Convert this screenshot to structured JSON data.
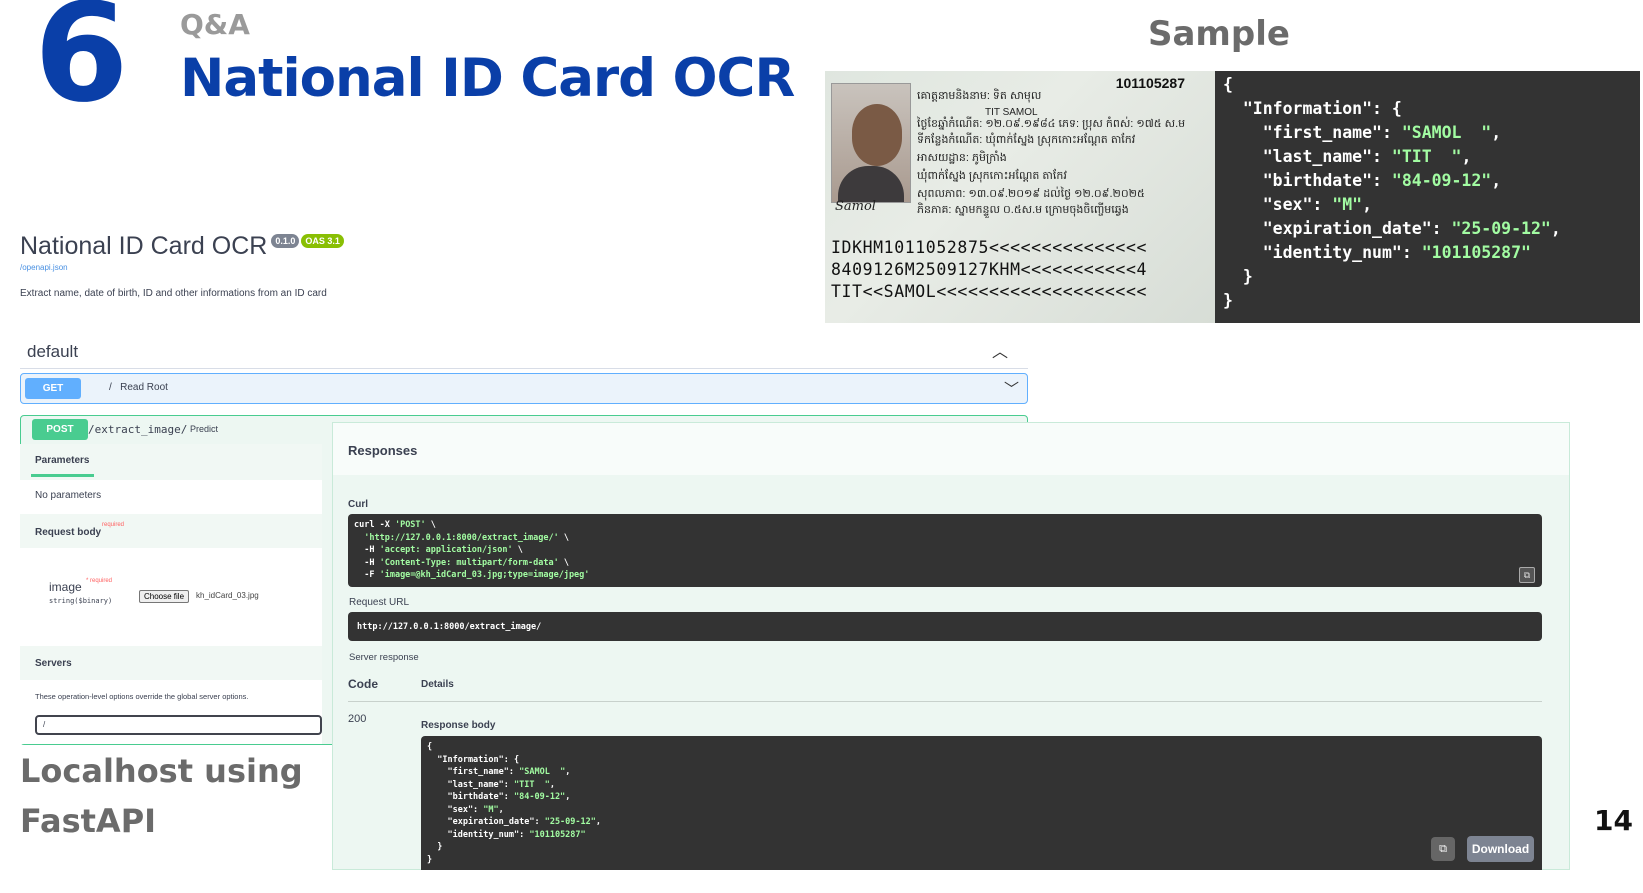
{
  "slide": {
    "number": "6",
    "section": "Q&A",
    "title": "National ID Card OCR",
    "sample_label": "Sample",
    "caption_line1": "Localhost using",
    "caption_line2": "FastAPI",
    "page_number": "14"
  },
  "id_card": {
    "id_number": "101105287",
    "name_en": "TIT SAMOL",
    "khmer_line1": "គោត្តនាមនិងនាម: ទិត សាមុល",
    "khmer_line2": "ថ្ងៃខែឆ្នាំកំណើត: ១២.០៩.១៩៨៤ ភេទ: ប្រុស កំពស់: ១៧៥ ស.ម",
    "khmer_line3": "ទីកន្លែងកំណើត: ឃុំពាក់ស្នែង ស្រុកកោះអណ្តែត តាកែវ",
    "khmer_line4": "អាសយដ្ឋាន: ភូមិក្រាំង",
    "khmer_line5": "ឃុំពាក់ស្នែង ស្រុកកោះអណ្តែត តាកែវ",
    "khmer_line6": "សុពលភាព: ១៣.០៩.២០១៩ ដល់ថ្ងៃ ១២.០៩.២០២៥",
    "khmer_line7": "ភិនភាគ: ស្នាមកន្ទួល ០.៥ស.ម ក្រោមចុងចិញ្ចើមឆ្វេង",
    "signature": "Samol",
    "mrz": [
      "IDKHM1011052875<<<<<<<<<<<<<<<",
      "8409126M2509127KHM<<<<<<<<<<<4",
      "TIT<<SAMOL<<<<<<<<<<<<<<<<<<<<"
    ]
  },
  "json_sample": {
    "open": "{",
    "information_key": "\"Information\": {",
    "fields": [
      {
        "key": "\"first_name\": ",
        "value": "\"SAMOL  \"",
        "tail": ","
      },
      {
        "key": "\"last_name\": ",
        "value": "\"TIT  \"",
        "tail": ","
      },
      {
        "key": "\"birthdate\": ",
        "value": "\"84-09-12\"",
        "tail": ","
      },
      {
        "key": "\"sex\": ",
        "value": "\"M\"",
        "tail": ","
      },
      {
        "key": "\"expiration_date\": ",
        "value": "\"25-09-12\"",
        "tail": ","
      },
      {
        "key": "\"identity_num\": ",
        "value": "\"101105287\"",
        "tail": ""
      }
    ],
    "inner_close": "}",
    "close": "}"
  },
  "swagger": {
    "title": "National ID Card OCR",
    "version": "0.1.0",
    "oas": "OAS 3.1",
    "openapi_link": "/openapi.json",
    "description": "Extract name, date of birth, ID and other informations from an ID card",
    "tag": "default",
    "get": {
      "method": "GET",
      "path": "/",
      "summary": "Read Root"
    },
    "post": {
      "method": "POST",
      "path": "/extract_image/",
      "summary": "Predict"
    },
    "parameters_tab": "Parameters",
    "no_parameters": "No parameters",
    "request_body": "Request body",
    "required": "required",
    "image_label": "image",
    "image_required": "* required",
    "image_type": "string($binary)",
    "choose_file": "Choose file",
    "file_name": "kh_idCard_03.jpg",
    "servers_label": "Servers",
    "servers_note": "These operation-level options override the global server options.",
    "server_value": "/",
    "responses_title": "Responses",
    "curl_label": "Curl",
    "curl": [
      {
        "a": "curl -X ",
        "s": "'POST'",
        "b": " \\"
      },
      {
        "a": "  ",
        "s": "'http://127.0.0.1:8000/extract_image/'",
        "b": " \\"
      },
      {
        "a": "  -H ",
        "s": "'accept: application/json'",
        "b": " \\"
      },
      {
        "a": "  -H ",
        "s": "'Content-Type: multipart/form-data'",
        "b": " \\"
      },
      {
        "a": "  -F ",
        "s": "'image=@kh_idCard_03.jpg;type=image/jpeg'",
        "b": ""
      }
    ],
    "request_url_label": "Request URL",
    "request_url": "http://127.0.0.1:8000/extract_image/",
    "server_response": "Server response",
    "code_header": "Code",
    "details_header": "Details",
    "status_code": "200",
    "response_body_label": "Response body",
    "response_body": [
      {
        "k": "{",
        "v": "",
        "t": ""
      },
      {
        "k": "  \"Information\": {",
        "v": "",
        "t": ""
      },
      {
        "k": "    \"first_name\": ",
        "v": "\"SAMOL  \"",
        "t": ","
      },
      {
        "k": "    \"last_name\": ",
        "v": "\"TIT  \"",
        "t": ","
      },
      {
        "k": "    \"birthdate\": ",
        "v": "\"84-09-12\"",
        "t": ","
      },
      {
        "k": "    \"sex\": ",
        "v": "\"M\"",
        "t": ","
      },
      {
        "k": "    \"expiration_date\": ",
        "v": "\"25-09-12\"",
        "t": ","
      },
      {
        "k": "    \"identity_num\": ",
        "v": "\"101105287\"",
        "t": ""
      },
      {
        "k": "  }",
        "v": "",
        "t": ""
      },
      {
        "k": "}",
        "v": "",
        "t": ""
      }
    ],
    "download": "Download"
  },
  "colors": {
    "brand_blue": "#0a3fa8",
    "get": "#61affe",
    "post": "#49cc90",
    "json_string": "#a2fca2"
  },
  "icons": [
    "chevron-up-icon",
    "chevron-down-icon",
    "copy-icon"
  ]
}
